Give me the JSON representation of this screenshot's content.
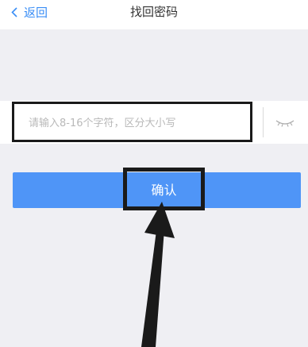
{
  "header": {
    "back_label": "返回",
    "title": "找回密码"
  },
  "password_input": {
    "placeholder": "请输入8-16个字符，区分大小写",
    "visibility_icon": "eye-closed-icon"
  },
  "confirm_button": {
    "label": "确认"
  },
  "annotation": {
    "type": "arrow-pointing-to-confirm-button"
  },
  "colors": {
    "accent": "#3a8ef6",
    "button": "#4f95f7",
    "background": "#efeff3",
    "highlight_box": "#1a1a1a"
  }
}
